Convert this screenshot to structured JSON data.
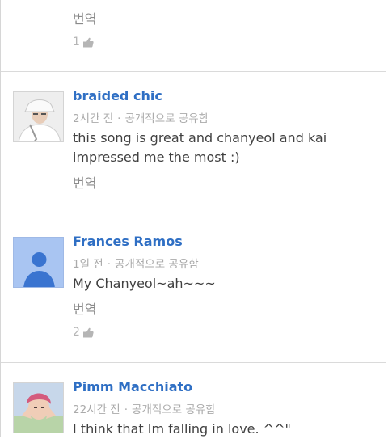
{
  "comments": [
    {
      "translate": "번역",
      "likes": "1"
    },
    {
      "author": "braided chic",
      "time": "2시간 전",
      "visibility": "공개적으로 공유함",
      "text": "this song is great and chanyeol and kai impressed me the most :)",
      "translate": "번역"
    },
    {
      "author": "Frances Ramos",
      "time": "1일 전",
      "visibility": "공개적으로 공유함",
      "text": "My Chanyeol~ah~~~",
      "translate": "번역",
      "likes": "2"
    },
    {
      "author": "Pimm Macchiato",
      "time": "22시간 전",
      "visibility": "공개적으로 공유함",
      "text": "I think that Im falling in love. ^^\""
    }
  ],
  "separator": "·",
  "colors": {
    "author": "#2f6fc4",
    "meta": "#aaaaaa",
    "default_avatar": "#a9c5f2"
  }
}
